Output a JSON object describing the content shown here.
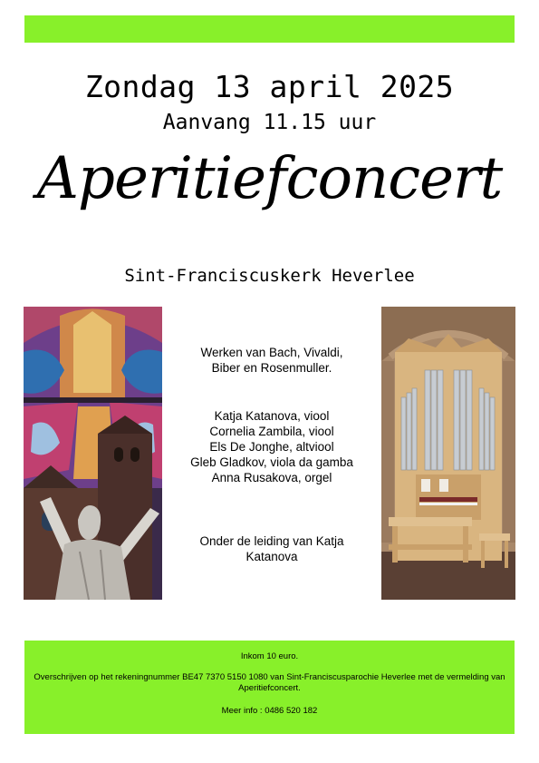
{
  "header": {
    "date": "Zondag 13 april 2025",
    "start_time": "Aanvang 11.15 uur",
    "title": "Aperitiefconcert",
    "venue": "Sint-Franciscuskerk Heverlee"
  },
  "program": {
    "works": [
      "Werken van Bach, Vivaldi,",
      "Biber en Rosenmuller."
    ],
    "performers": [
      "Katja Katanova, viool",
      "Cornelia Zambila, viool",
      "Els De Jonghe, altviool",
      "Gleb Gladkov, viola da gamba",
      "Anna Rusakova, orgel"
    ],
    "direction": [
      "Onder de leiding van Katja",
      "Katanova"
    ]
  },
  "footer": {
    "entry": "Inkom 10 euro.",
    "transfer": "Overschrijven op het rekeningnummer BE47 7370 5150 1080 van Sint-Franciscusparochie Heverlee met de vermelding van Aperitiefconcert.",
    "info": "Meer info : 0486 520 182"
  },
  "colors": {
    "accent_green": "#88f02a"
  },
  "images": {
    "left": "church-stained-glass-and-statue-photo",
    "right": "pipe-organ-photo"
  }
}
